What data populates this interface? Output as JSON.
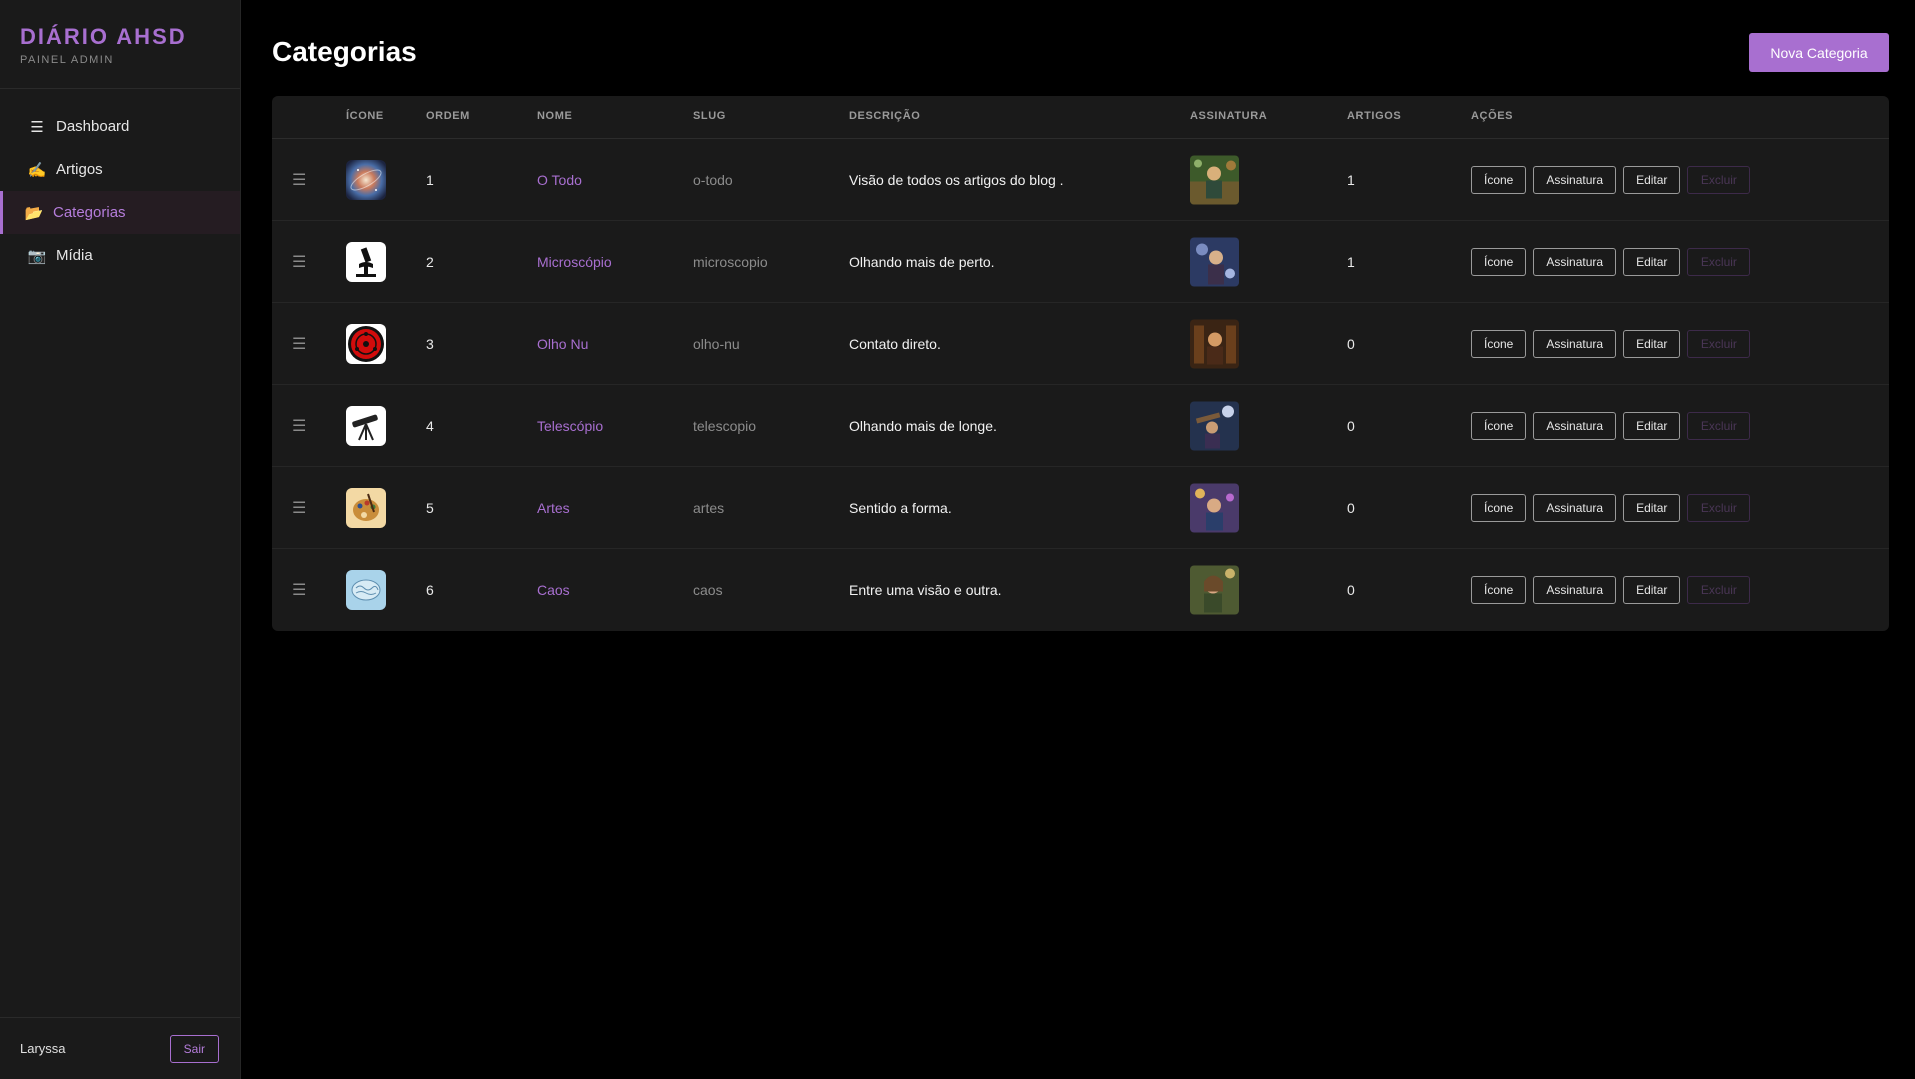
{
  "sidebar": {
    "brand_title": "DIÁRIO AHSD",
    "brand_subtitle": "PAINEL ADMIN",
    "items": [
      {
        "label": "Dashboard",
        "icon": "menu-icon",
        "glyph": "☰"
      },
      {
        "label": "Artigos",
        "icon": "writing-hand-icon",
        "glyph": "✍"
      },
      {
        "label": "Categorias",
        "icon": "open-folder-icon",
        "glyph": "📂",
        "active": true
      },
      {
        "label": "Mídia",
        "icon": "camera-icon",
        "glyph": "📷"
      }
    ],
    "username": "Laryssa",
    "logout_label": "Sair"
  },
  "header": {
    "title": "Categorias",
    "new_button_label": "Nova Categoria"
  },
  "table": {
    "columns": {
      "icone": "ÍCONE",
      "ordem": "ORDEM",
      "nome": "NOME",
      "slug": "SLUG",
      "descricao": "DESCRIÇÃO",
      "assinatura": "ASSINATURA",
      "artigos": "ARTIGOS",
      "acoes": "AÇÕES"
    },
    "action_labels": {
      "icone": "Ícone",
      "assinatura": "Assinatura",
      "editar": "Editar",
      "excluir": "Excluir"
    },
    "drag_glyph": "☰",
    "rows": [
      {
        "ordem": "1",
        "nome": "O Todo",
        "slug": "o-todo",
        "descricao": "Visão de todos os artigos do blog .",
        "artigos": "1",
        "icon": "galaxy-icon"
      },
      {
        "ordem": "2",
        "nome": "Microscópio",
        "slug": "microscopio",
        "descricao": "Olhando mais de perto.",
        "artigos": "1",
        "icon": "microscope-icon"
      },
      {
        "ordem": "3",
        "nome": "Olho Nu",
        "slug": "olho-nu",
        "descricao": "Contato direto.",
        "artigos": "0",
        "icon": "red-eye-icon"
      },
      {
        "ordem": "4",
        "nome": "Telescópio",
        "slug": "telescopio",
        "descricao": "Olhando mais de longe.",
        "artigos": "0",
        "icon": "telescope-icon"
      },
      {
        "ordem": "5",
        "nome": "Artes",
        "slug": "artes",
        "descricao": "Sentido a forma.",
        "artigos": "0",
        "icon": "palette-icon"
      },
      {
        "ordem": "6",
        "nome": "Caos",
        "slug": "caos",
        "descricao": "Entre uma visão e outra.",
        "artigos": "0",
        "icon": "brain-icon"
      }
    ]
  },
  "colors": {
    "accent": "#a86fd0",
    "background": "#000000",
    "panel": "#1a1a1a"
  }
}
